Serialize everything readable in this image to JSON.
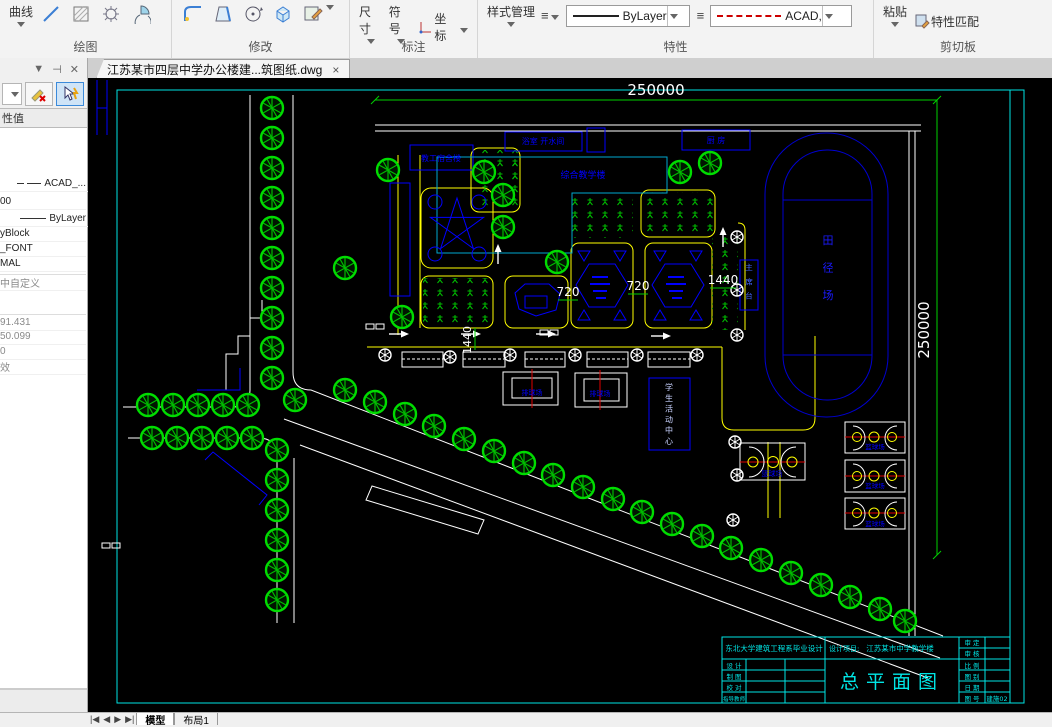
{
  "ribbon": {
    "draw": {
      "label": "绘图",
      "curve": "曲线"
    },
    "modify": {
      "label": "修改"
    },
    "annotate": {
      "label": "标注",
      "dimension": "尺寸",
      "symbol": "符号",
      "coordinate": "坐标"
    },
    "properties": {
      "label": "特性",
      "style_manager": "样式管理",
      "linetype_current": "ByLayer",
      "linetype_alt": "ACAD,"
    },
    "clipboard": {
      "label": "剪切板",
      "paste": "粘贴",
      "match_properties": "特性匹配"
    }
  },
  "doc_tab": {
    "title": "江苏某市四层中学办公楼建...筑图纸.dwg",
    "close": "×"
  },
  "palette": {
    "header": "性值",
    "rows": [
      "ACAD_...",
      "00",
      "ByLayer",
      "yBlock",
      "_FONT",
      "MAL",
      "中自定义",
      "91.431",
      "50.099",
      "0",
      "效"
    ]
  },
  "statusbar": {
    "nav": [
      "|◀",
      "◀",
      "▶",
      "▶|"
    ],
    "model": "模型",
    "layout1": "布局1"
  },
  "drawing": {
    "dim_top": "250000",
    "dim_right": "250000",
    "dim_720a": "720",
    "dim_720b": "720",
    "dim_1440": "1440",
    "dim_1440v": "1440",
    "labels": {
      "staff_dorm": "教工宿舍楼",
      "bath": "浴室 开水间",
      "kitchen": "厨 房",
      "teaching": "综合教学楼",
      "rostrum": "主席台",
      "track": "田径场",
      "student_center": "学生活动中心",
      "basketball": "篮球场",
      "volleyball": "排球场"
    },
    "titleblock": {
      "dept": "东北大学建筑工程系毕业设计",
      "project_label": "设计项目:",
      "project_name": "江苏某市中学教学楼",
      "title": "总平面图",
      "row_design": "设 计",
      "row_draft": "制 图",
      "row_check": "校 对",
      "row_advisor": "指导教师",
      "row_approve": "审 定",
      "row_review": "审 核",
      "row_scale": "比 例",
      "row_type": "图 别",
      "row_date": "日 期",
      "row_no": "图 号",
      "drawing_no": "建施02"
    }
  }
}
